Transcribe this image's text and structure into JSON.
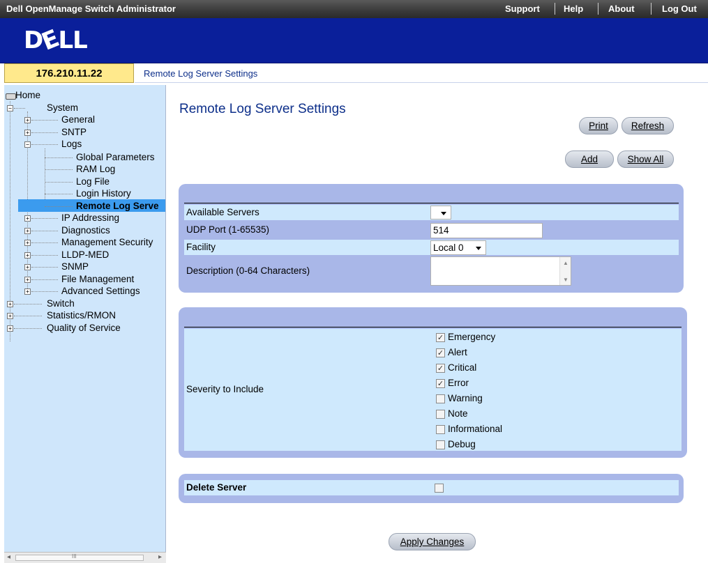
{
  "topbar": {
    "title": "Dell OpenManage Switch Administrator",
    "links": [
      "Support",
      "Help",
      "About",
      "Log Out"
    ]
  },
  "brand": {
    "logo": "DELL"
  },
  "address": {
    "ip": "176.210.11.22",
    "breadcrumb": "Remote Log Server Settings"
  },
  "tree": {
    "home": "Home",
    "system": "System",
    "general": "General",
    "sntp": "SNTP",
    "logs": "Logs",
    "global_parameters": "Global Parameters",
    "ram_log": "RAM Log",
    "log_file": "Log File",
    "login_history": "Login History",
    "remote_log_server": "Remote Log Serve",
    "ip_addressing": "IP Addressing",
    "diagnostics": "Diagnostics",
    "management_security": "Management Security",
    "lldp_med": "LLDP-MED",
    "snmp": "SNMP",
    "file_management": "File Management",
    "advanced_settings": "Advanced Settings",
    "switch": "Switch",
    "statistics_rmon": "Statistics/RMON",
    "quality_of_service": "Quality of Service"
  },
  "scrollbar": {
    "thumb_glyph": "III"
  },
  "main": {
    "title": "Remote Log Server Settings",
    "buttons": {
      "print": "Print",
      "refresh": "Refresh",
      "add": "Add",
      "show_all": "Show All",
      "apply": "Apply Changes"
    },
    "form": {
      "available_servers_label": "Available Servers",
      "available_servers_value": "",
      "udp_port_label": "UDP Port (1-65535)",
      "udp_port_value": "514",
      "facility_label": "Facility",
      "facility_value": "Local 0",
      "description_label": "Description (0-64 Characters)",
      "description_value": ""
    },
    "severity": {
      "label": "Severity to Include",
      "items": [
        {
          "label": "Emergency",
          "checked": true
        },
        {
          "label": "Alert",
          "checked": true
        },
        {
          "label": "Critical",
          "checked": true
        },
        {
          "label": "Error",
          "checked": true
        },
        {
          "label": "Warning",
          "checked": false
        },
        {
          "label": "Note",
          "checked": false
        },
        {
          "label": "Informational",
          "checked": false
        },
        {
          "label": "Debug",
          "checked": false
        }
      ]
    },
    "delete": {
      "label": "Delete Server",
      "checked": false
    }
  },
  "colors": {
    "brand_blue": "#0a1f9a",
    "panel": "#a9b7e8",
    "row": "#cfe9fd",
    "sidebar": "#cfe6fb",
    "ip_box": "#ffe98c"
  }
}
